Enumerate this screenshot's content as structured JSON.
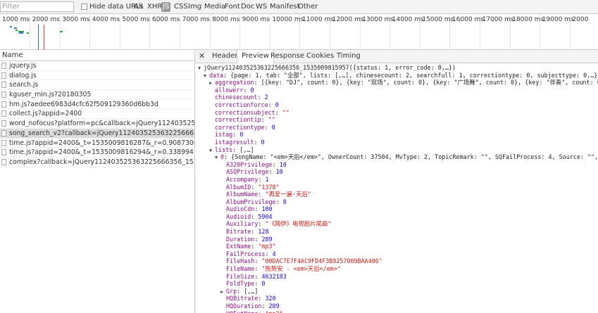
{
  "filter": {
    "placeholder": "Filter",
    "hide_data_urls": "Hide data URLs",
    "types": [
      "All",
      "XHR",
      "JS",
      "CSS",
      "Img",
      "Media",
      "Font",
      "Doc",
      "WS",
      "Manifest",
      "Other"
    ],
    "active_type": "JS"
  },
  "timeline": {
    "ticks": [
      "1000 ms",
      "2000 ms",
      "3000 ms",
      "4000 ms",
      "5000 ms",
      "6000 ms",
      "7000 ms",
      "8000 ms",
      "9000 ms",
      "10000 ms",
      "11000 ms",
      "12000 ms",
      "13000 ms",
      "14000 ms",
      "15000 ms",
      "16000 ms",
      "17000 ms",
      "18000 ms",
      "19000 ms",
      "2000"
    ]
  },
  "requests": {
    "header": "Name",
    "items": [
      "jquery.js",
      "dialog.js",
      "search.js",
      "kguser_min.js?20180305",
      "hm.js?aedee6983d4cfc62f509129360d6bb3d",
      "collect.js?appid=2400",
      "word_nofocus?platform=pc&callback=jQuery11240352536322566635...",
      "song_search_v2?callback=jQuery11240352536322566635...iscorrecti...",
      "time.js?appid=2400&_t=1535009816287&_r=0.908730088...5185dc...",
      "time.js?appid=2400&_t=1535009816294&_r=0.338994101...994f0bf...",
      "complex?callback=jQuery112403525363225666356_153500981595..."
    ],
    "selected_index": 7
  },
  "detail_tabs": [
    "Headers",
    "Preview",
    "Response",
    "Cookies",
    "Timing"
  ],
  "active_tab": "Preview",
  "preview": [
    {
      "indent": 0,
      "arrow": "▼",
      "key": "",
      "sep": "",
      "text": "jQuery112403525363225666356_1535009815957({status: 1, error_code: 0,…})",
      "vt": "p"
    },
    {
      "indent": 1,
      "arrow": "▼",
      "key": "data",
      "sep": ": ",
      "text": "{page: 1, tab: \"全部\", lists: [,…], chinesecount: 2, searchfull: 1, correctiontype: 0, subjecttype: 0,…}",
      "vt": "p"
    },
    {
      "indent": 2,
      "arrow": "▶",
      "key": "aggregation",
      "sep": ": ",
      "text": "[{key: \"DJ\", count: 0}, {key: \"现场\", count: 0}, {key: \"广场舞\", count: 0}, {key: \"伴奏\", count: 0},…]",
      "vt": "p"
    },
    {
      "indent": 2,
      "arrow": "",
      "key": "allowerr",
      "sep": ": ",
      "text": "0",
      "vt": "n"
    },
    {
      "indent": 2,
      "arrow": "",
      "key": "chinesecount",
      "sep": ": ",
      "text": "2",
      "vt": "n"
    },
    {
      "indent": 2,
      "arrow": "",
      "key": "correctionforce",
      "sep": ": ",
      "text": "0",
      "vt": "n"
    },
    {
      "indent": 2,
      "arrow": "",
      "key": "correctionsubject",
      "sep": ": ",
      "text": "\"\"",
      "vt": "s"
    },
    {
      "indent": 2,
      "arrow": "",
      "key": "correctiontip",
      "sep": ": ",
      "text": "\"\"",
      "vt": "s"
    },
    {
      "indent": 2,
      "arrow": "",
      "key": "correctiontype",
      "sep": ": ",
      "text": "0",
      "vt": "n"
    },
    {
      "indent": 2,
      "arrow": "",
      "key": "istag",
      "sep": ": ",
      "text": "0",
      "vt": "n"
    },
    {
      "indent": 2,
      "arrow": "",
      "key": "istagresult",
      "sep": ": ",
      "text": "0",
      "vt": "n"
    },
    {
      "indent": 2,
      "arrow": "▼",
      "key": "lists",
      "sep": ": ",
      "text": "[,…]",
      "vt": "p"
    },
    {
      "indent": 3,
      "arrow": "▼",
      "key": "0",
      "sep": ": ",
      "text": "{SongName: \"<em>天后</em>\", OwnerCount: 37504, MvType: 2, TopicRemark: \"\", SQFailProcess: 4, Source: \"\",…}",
      "vt": "p"
    },
    {
      "indent": 4,
      "arrow": "",
      "key": "A320Privilege",
      "sep": ": ",
      "text": "10",
      "vt": "n"
    },
    {
      "indent": 4,
      "arrow": "",
      "key": "ASQPrivilege",
      "sep": ": ",
      "text": "10",
      "vt": "n"
    },
    {
      "indent": 4,
      "arrow": "",
      "key": "Accompany",
      "sep": ": ",
      "text": "1",
      "vt": "n"
    },
    {
      "indent": 4,
      "arrow": "",
      "key": "AlbumID",
      "sep": ": ",
      "text": "\"1378\"",
      "vt": "s"
    },
    {
      "indent": 4,
      "arrow": "",
      "key": "AlbumName",
      "sep": ": ",
      "text": "\"再爱一遍·天后\"",
      "vt": "s"
    },
    {
      "indent": 4,
      "arrow": "",
      "key": "AlbumPrivilege",
      "sep": ": ",
      "text": "8",
      "vt": "n"
    },
    {
      "indent": 4,
      "arrow": "",
      "key": "AudioCdn",
      "sep": ": ",
      "text": "100",
      "vt": "n"
    },
    {
      "indent": 4,
      "arrow": "",
      "key": "Audioid",
      "sep": ": ",
      "text": "5904",
      "vt": "n"
    },
    {
      "indent": 4,
      "arrow": "",
      "key": "Auxiliary",
      "sep": ": ",
      "text": "\"《网伊》电视剧片尾曲\"",
      "vt": "s"
    },
    {
      "indent": 4,
      "arrow": "",
      "key": "Bitrate",
      "sep": ": ",
      "text": "128",
      "vt": "n"
    },
    {
      "indent": 4,
      "arrow": "",
      "key": "Duration",
      "sep": ": ",
      "text": "289",
      "vt": "n"
    },
    {
      "indent": 4,
      "arrow": "",
      "key": "ExtName",
      "sep": ": ",
      "text": "\"mp3\"",
      "vt": "s"
    },
    {
      "indent": 4,
      "arrow": "",
      "key": "FailProcess",
      "sep": ": ",
      "text": "4",
      "vt": "n"
    },
    {
      "indent": 4,
      "arrow": "",
      "key": "FileHash",
      "sep": ": ",
      "text": "\"00DAC7E7F4AC9FD4F3B9257009BAA406\"",
      "vt": "s"
    },
    {
      "indent": 4,
      "arrow": "",
      "key": "FileName",
      "sep": ": ",
      "text": "\"陈势安 - <em>天后</em>\"",
      "vt": "s"
    },
    {
      "indent": 4,
      "arrow": "",
      "key": "FileSize",
      "sep": ": ",
      "text": "4632183",
      "vt": "n"
    },
    {
      "indent": 4,
      "arrow": "",
      "key": "FoldType",
      "sep": ": ",
      "text": "0",
      "vt": "n"
    },
    {
      "indent": 4,
      "arrow": "▶",
      "key": "Grp",
      "sep": ": ",
      "text": "[,…]",
      "vt": "p"
    },
    {
      "indent": 4,
      "arrow": "",
      "key": "HQBitrate",
      "sep": ": ",
      "text": "320",
      "vt": "n"
    },
    {
      "indent": 4,
      "arrow": "",
      "key": "HQDuration",
      "sep": ": ",
      "text": "289",
      "vt": "n"
    },
    {
      "indent": 4,
      "arrow": "",
      "key": "HQExtName",
      "sep": ": ",
      "text": "\"mp3\"",
      "vt": "s"
    }
  ]
}
